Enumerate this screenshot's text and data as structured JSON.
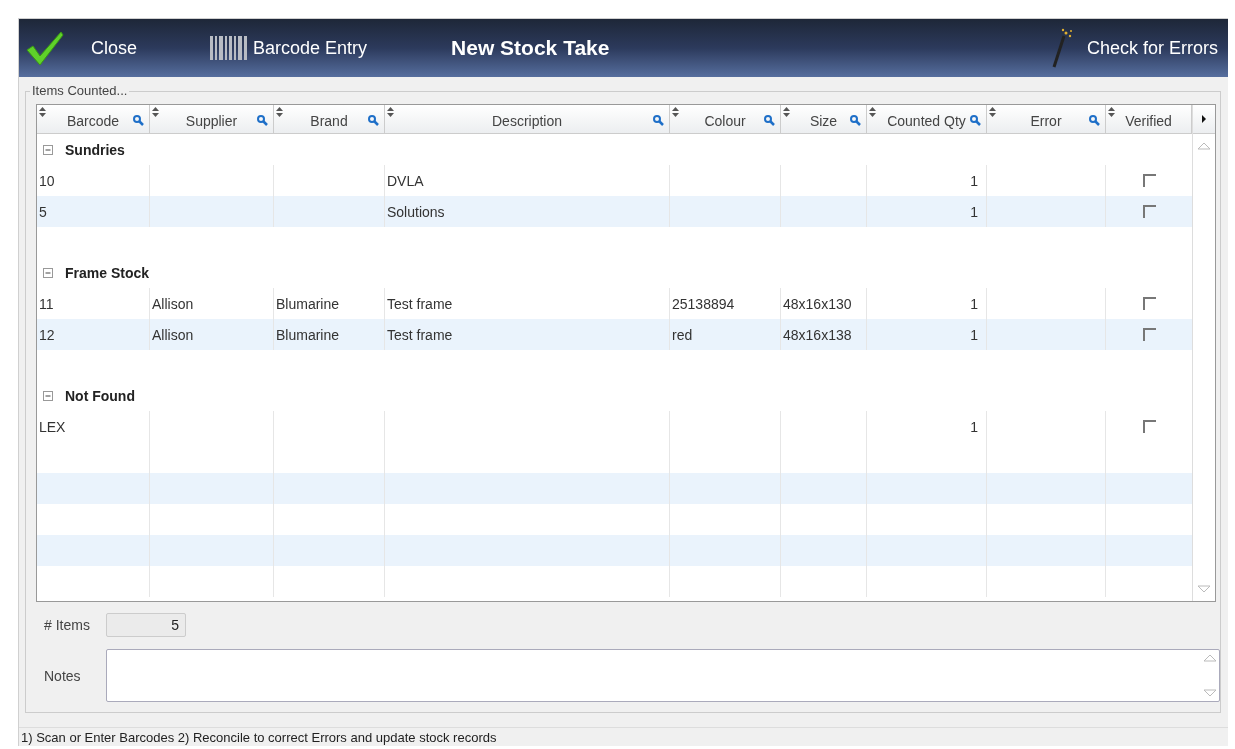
{
  "header": {
    "close_button": "Close",
    "barcode_button": "Barcode Entry",
    "title": "New Stock Take",
    "check_button": "Check for Errors"
  },
  "group_box": {
    "title": "Items Counted..."
  },
  "table": {
    "columns": [
      {
        "label": "Barcode",
        "filter": true
      },
      {
        "label": "Supplier",
        "filter": true
      },
      {
        "label": "Brand",
        "filter": true
      },
      {
        "label": "Description",
        "filter": true
      },
      {
        "label": "Colour",
        "filter": true
      },
      {
        "label": "Size",
        "filter": true
      },
      {
        "label": "Counted Qty",
        "filter": true
      },
      {
        "label": "Error",
        "filter": true
      },
      {
        "label": "Verified",
        "filter": false
      }
    ],
    "groups": [
      {
        "name": "Sundries",
        "expanded": true,
        "rows": [
          {
            "barcode": "10",
            "description": "DVLA",
            "counted_qty": "1",
            "verified": false
          },
          {
            "barcode": "5",
            "description": "Solutions",
            "counted_qty": "1",
            "verified": false
          }
        ]
      },
      {
        "name": "Frame Stock",
        "expanded": true,
        "rows": [
          {
            "barcode": "11",
            "supplier": "Allison",
            "brand": "Blumarine",
            "description": "Test frame",
            "colour": "25138894",
            "size": "48x16x130",
            "counted_qty": "1",
            "verified": false
          },
          {
            "barcode": "12",
            "supplier": "Allison",
            "brand": "Blumarine",
            "description": "Test frame",
            "colour": "red",
            "size": "48x16x138",
            "counted_qty": "1",
            "verified": false
          }
        ]
      },
      {
        "name": "Not Found",
        "expanded": true,
        "rows": [
          {
            "barcode": "LEX",
            "counted_qty": "1",
            "verified": false
          }
        ]
      }
    ]
  },
  "items_count": {
    "label": "# Items",
    "value": "5"
  },
  "notes": {
    "label": "Notes"
  },
  "status_bar": "1) Scan or Enter Barcodes  2) Reconcile to correct Errors and update stock records"
}
